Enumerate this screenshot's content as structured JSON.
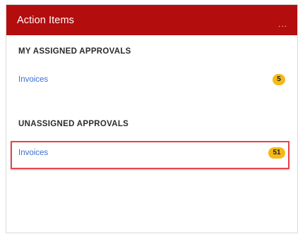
{
  "widget": {
    "title": "Action Items",
    "menu_label": "...",
    "colors": {
      "header_bg": "#b30d0d",
      "link": "#3d6fcf",
      "badge": "#f5b915",
      "highlight": "#e8434a"
    }
  },
  "sections": [
    {
      "heading": "MY ASSIGNED APPROVALS",
      "items": [
        {
          "label": "Invoices",
          "count": "5"
        }
      ]
    },
    {
      "heading": "UNASSIGNED APPROVALS",
      "items": [
        {
          "label": "Invoices",
          "count": "51"
        }
      ]
    }
  ]
}
